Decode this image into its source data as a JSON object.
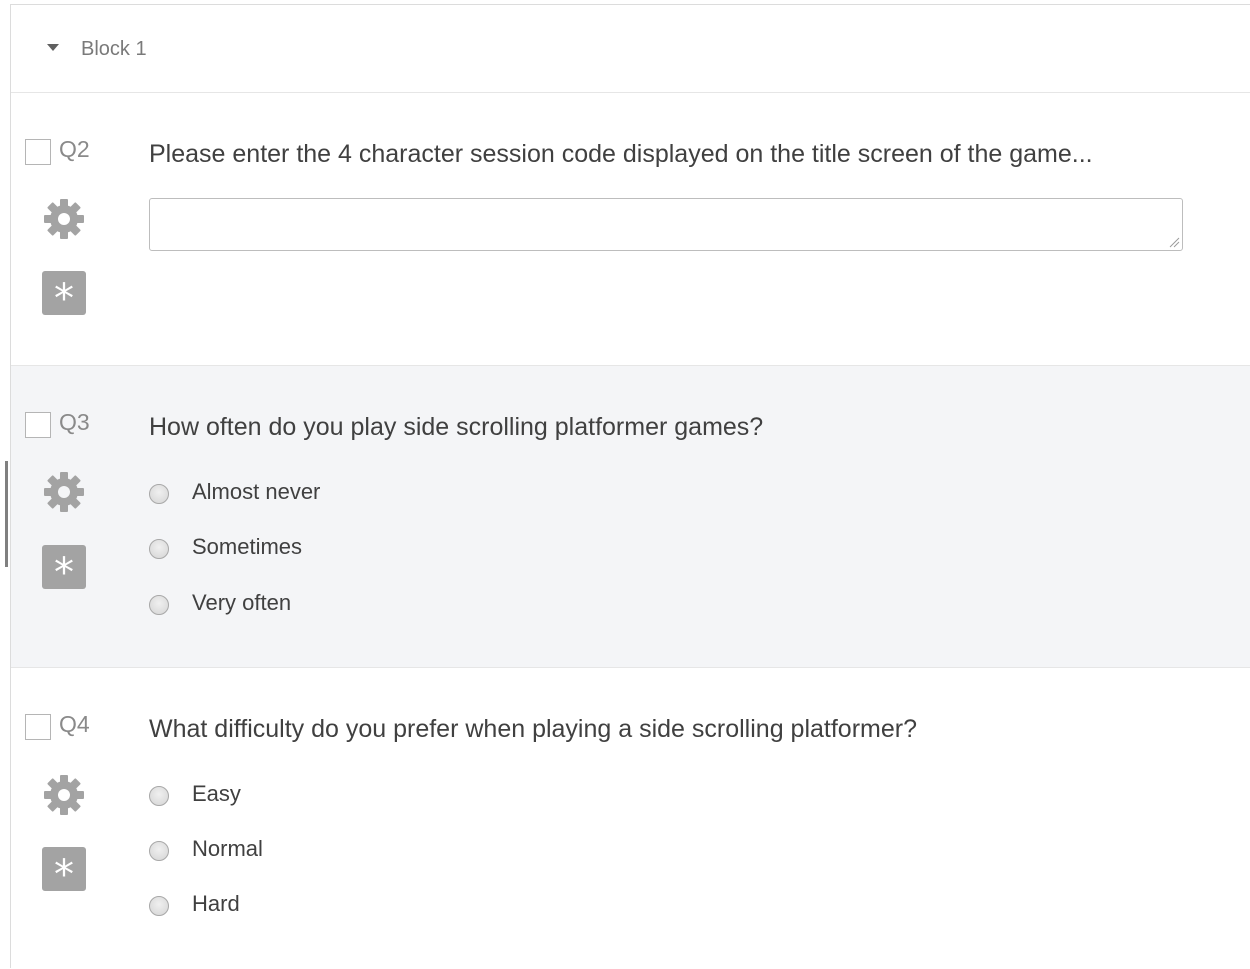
{
  "block": {
    "title": "Block 1"
  },
  "questions": [
    {
      "number": "Q2",
      "text": "Please enter the 4 character session code displayed on the title screen of the game...",
      "type": "text-entry",
      "answer_value": ""
    },
    {
      "number": "Q3",
      "text": "How often do you play side scrolling platformer games?",
      "type": "multiple-choice",
      "choices": [
        "Almost never",
        "Sometimes",
        "Very often"
      ]
    },
    {
      "number": "Q4",
      "text": "What difficulty do you prefer when playing a side scrolling platformer?",
      "type": "multiple-choice",
      "choices": [
        "Easy",
        "Normal",
        "Hard"
      ]
    }
  ],
  "icons": {
    "gear": "gear-icon",
    "required": "asterisk-icon",
    "caret": "caret-down-icon"
  },
  "colors": {
    "highlight_background": "#f4f5f7",
    "icon_gray": "#a3a3a3",
    "text": "#404040"
  }
}
